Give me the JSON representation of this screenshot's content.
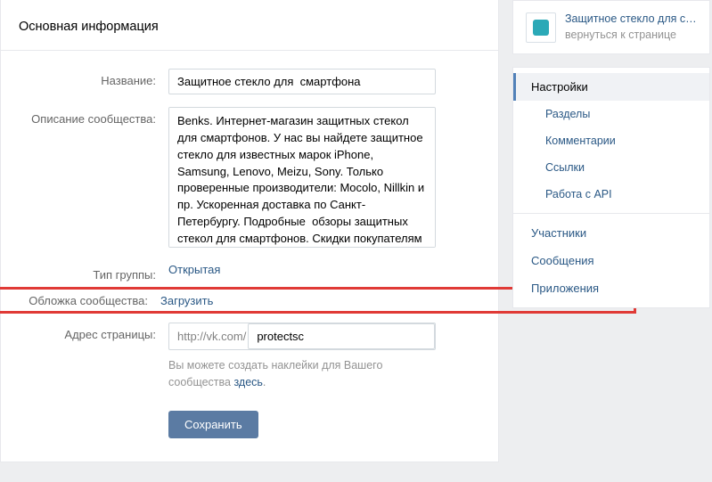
{
  "header": {
    "title": "Основная информация"
  },
  "form": {
    "name": {
      "label": "Название:",
      "value": "Защитное стекло для  смартфона"
    },
    "description": {
      "label": "Описание сообщества:",
      "value": "Benks. Интернет-магазин защитных стекол для смартфонов. У нас вы найдете защитное стекло для известных марок iPhone, Samsung, Lenovo, Meizu, Sony. Только проверенные производители: Mocolo, Nillkin и пр. Ускоренная доставка по Санкт-Петербургу. Подробные  обзоры защитных стекол для смартфонов. Скидки покупателям через группу Вконтакте."
    },
    "type": {
      "label": "Тип группы:",
      "value": "Открытая"
    },
    "cover": {
      "label": "Обложка сообщества:",
      "action": "Загрузить"
    },
    "address": {
      "label": "Адрес страницы:",
      "prefix": "http://vk.com/",
      "value": "protectsc",
      "hint_pre": "Вы можете создать наклейки для Вашего сообщества ",
      "hint_link": "здесь",
      "hint_post": "."
    },
    "save": "Сохранить"
  },
  "sidebar": {
    "community": {
      "title": "Защитное стекло для см...",
      "back": "вернуться к странице"
    },
    "items": [
      {
        "label": "Настройки",
        "active": true,
        "sub": false
      },
      {
        "label": "Разделы",
        "active": false,
        "sub": true
      },
      {
        "label": "Комментарии",
        "active": false,
        "sub": true
      },
      {
        "label": "Ссылки",
        "active": false,
        "sub": true
      },
      {
        "label": "Работа с API",
        "active": false,
        "sub": true
      },
      {
        "label": "Участники",
        "active": false,
        "sub": false
      },
      {
        "label": "Сообщения",
        "active": false,
        "sub": false
      },
      {
        "label": "Приложения",
        "active": false,
        "sub": false
      }
    ]
  }
}
